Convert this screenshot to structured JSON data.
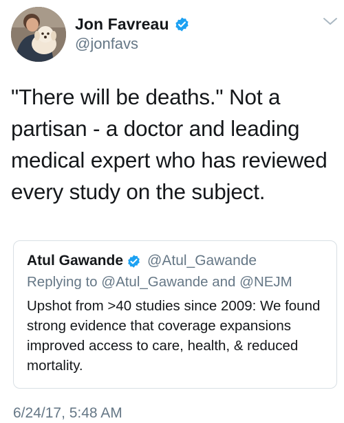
{
  "tweet": {
    "author": {
      "display_name": "Jon Favreau",
      "handle": "@jonfavs",
      "verified": true,
      "avatar_icon": "profile-photo-man-with-dog"
    },
    "menu_icon": "chevron-down-icon",
    "text": "\"There will be deaths.\" Not a partisan - a doctor and leading medical expert who has reviewed every study on the subject.",
    "quoted_tweet": {
      "display_name": "Atul Gawande",
      "handle": "@Atul_Gawande",
      "verified": true,
      "reply_context": "Replying to @Atul_Gawande and @NEJM",
      "text": "Upshot from >40 studies since 2009: We found strong evidence that coverage expansions improved access to care, health, & reduced mortality."
    },
    "timestamp": "6/24/17, 5:48 AM"
  },
  "colors": {
    "primary_text": "#14171a",
    "secondary_text": "#657786",
    "verified_badge": "#1da1f2",
    "card_border": "#d8dfe4"
  }
}
